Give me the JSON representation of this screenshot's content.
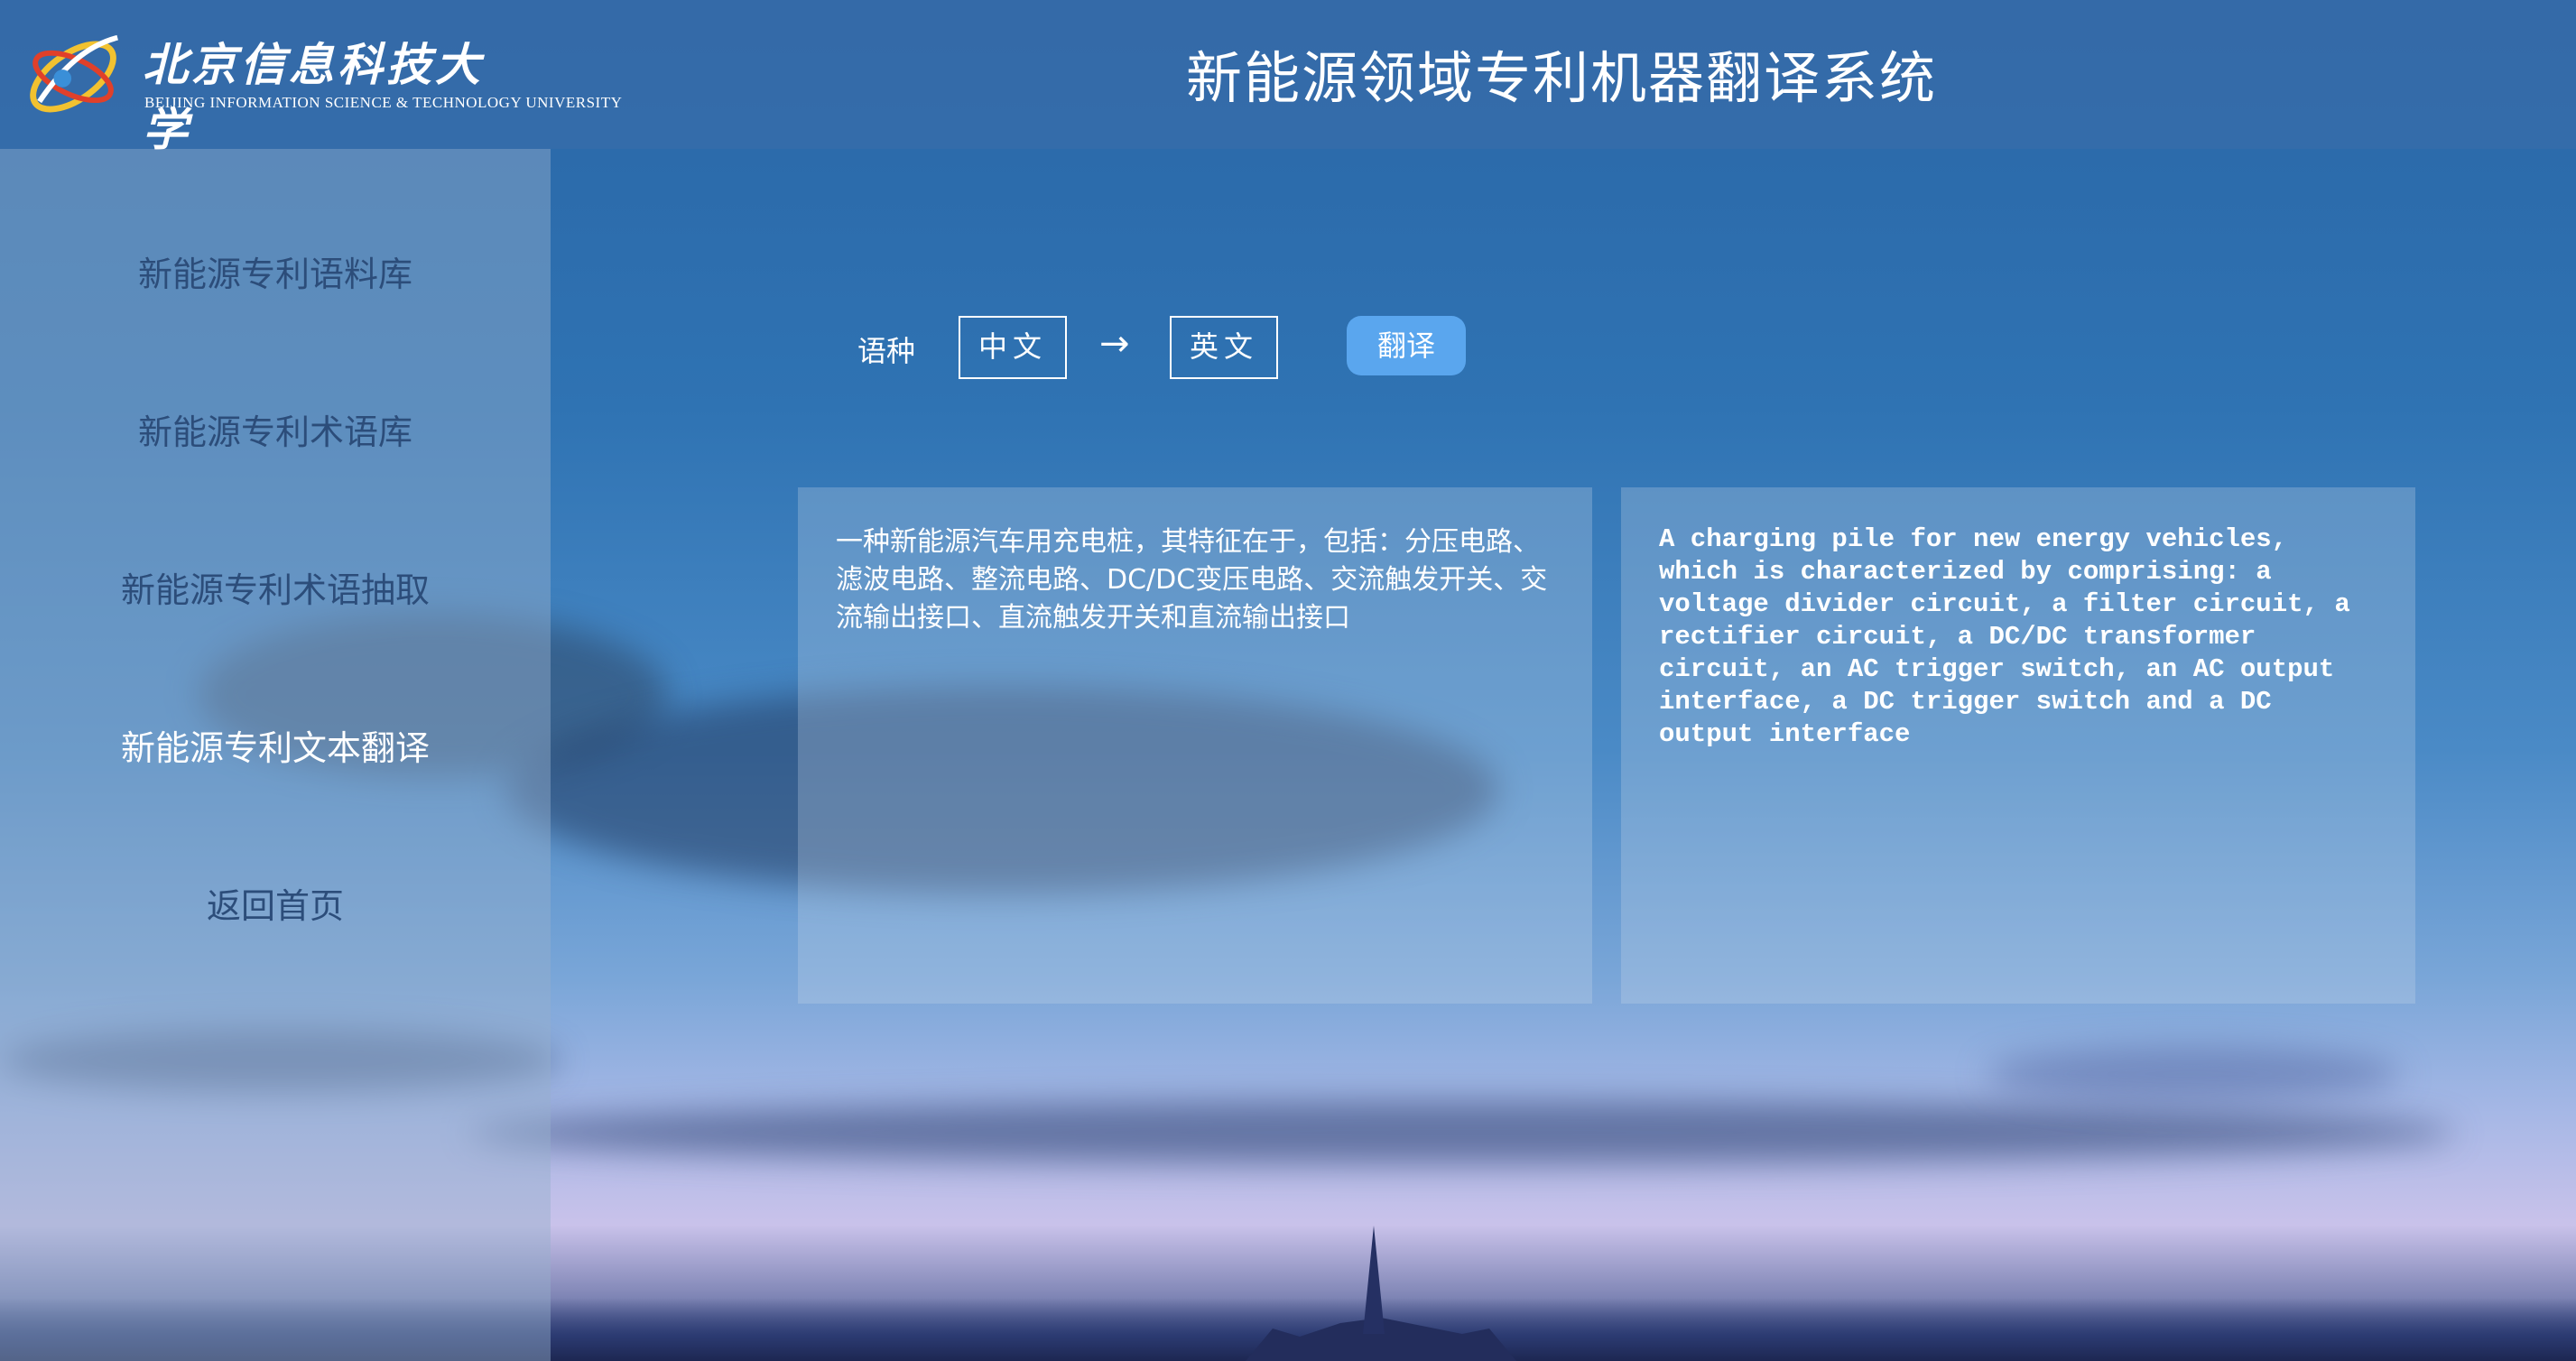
{
  "header": {
    "logo_cn": "北京信息科技大学",
    "logo_en": "BEIJING INFORMATION SCIENCE & TECHNOLOGY UNIVERSITY",
    "title": "新能源领域专利机器翻译系统"
  },
  "sidebar": {
    "items": [
      {
        "label": "新能源专利语料库",
        "active": false
      },
      {
        "label": "新能源专利术语库",
        "active": false
      },
      {
        "label": "新能源专利术语抽取",
        "active": false
      },
      {
        "label": "新能源专利文本翻译",
        "active": true
      },
      {
        "label": "返回首页",
        "active": false
      }
    ]
  },
  "translator": {
    "lang_label": "语种",
    "source_lang": "中文",
    "arrow": "→",
    "target_lang": "英文",
    "translate_button": "翻译",
    "source_text": "一种新能源汽车用充电桩，其特征在于，包括：分压电路、滤波电路、整流电路、DC/DC变压电路、交流触发开关、交流输出接口、直流触发开关和直流输出接口",
    "target_text": "A charging pile for new energy vehicles, which is characterized by comprising: a voltage divider circuit, a filter circuit, a rectifier circuit, a DC/DC transformer circuit, an AC trigger switch, an AC output interface, a DC trigger switch and a DC output interface"
  },
  "colors": {
    "header_bg": "#3c6eaa",
    "nav_text": "#2c4d7a",
    "nav_active": "#ffffff",
    "button_bg": "#5aa6ee"
  }
}
